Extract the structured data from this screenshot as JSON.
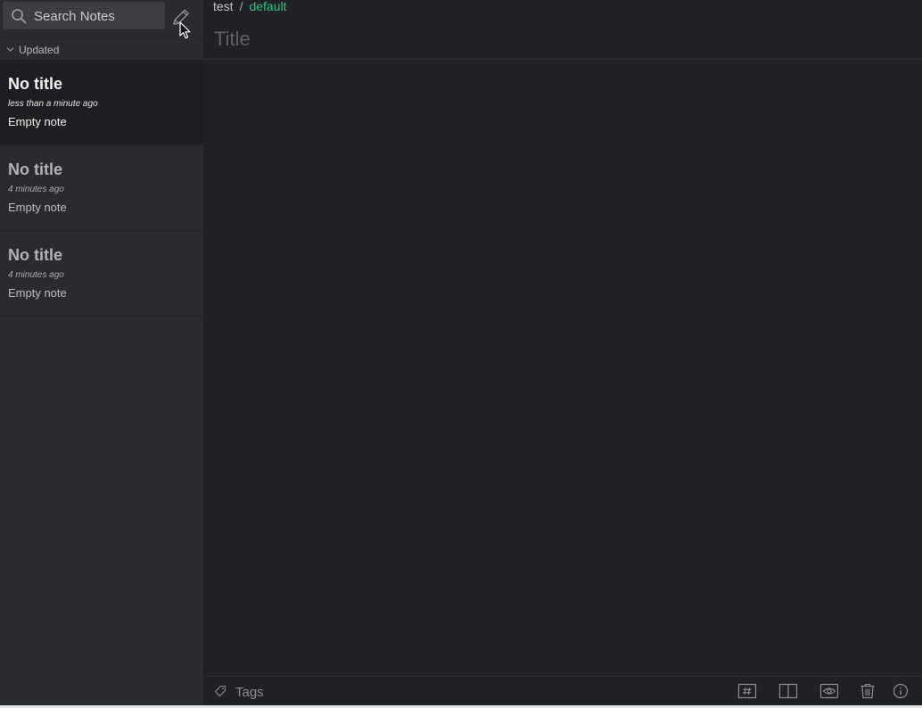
{
  "sidebar": {
    "search": {
      "placeholder": "Search Notes"
    },
    "new_note_icon": "pencil-icon",
    "sort": {
      "label": "Updated",
      "icon": "chevron-down-icon"
    },
    "notes": [
      {
        "title": "No title",
        "time": "less than a minute ago",
        "preview": "Empty note",
        "selected": true
      },
      {
        "title": "No title",
        "time": "4 minutes ago",
        "preview": "Empty note",
        "selected": false
      },
      {
        "title": "No title",
        "time": "4 minutes ago",
        "preview": "Empty note",
        "selected": false
      }
    ]
  },
  "editor": {
    "breadcrumb": {
      "parent": "test",
      "separator": "/",
      "current": "default"
    },
    "title": {
      "value": "",
      "placeholder": "Title"
    },
    "body": ""
  },
  "footer": {
    "tags": {
      "value": "",
      "placeholder": "Tags"
    },
    "tools": [
      {
        "icon": "hash-icon",
        "name": "markdown"
      },
      {
        "icon": "split-view-icon",
        "name": "split"
      },
      {
        "icon": "eye-icon",
        "name": "preview"
      },
      {
        "icon": "trash-icon",
        "name": "delete"
      },
      {
        "icon": "info-icon",
        "name": "info"
      }
    ]
  },
  "colors": {
    "accent": "#23c584",
    "sidebar_bg": "#2a2b2e",
    "selected_bg": "#1d1e21",
    "editor_bg": "#202124"
  }
}
